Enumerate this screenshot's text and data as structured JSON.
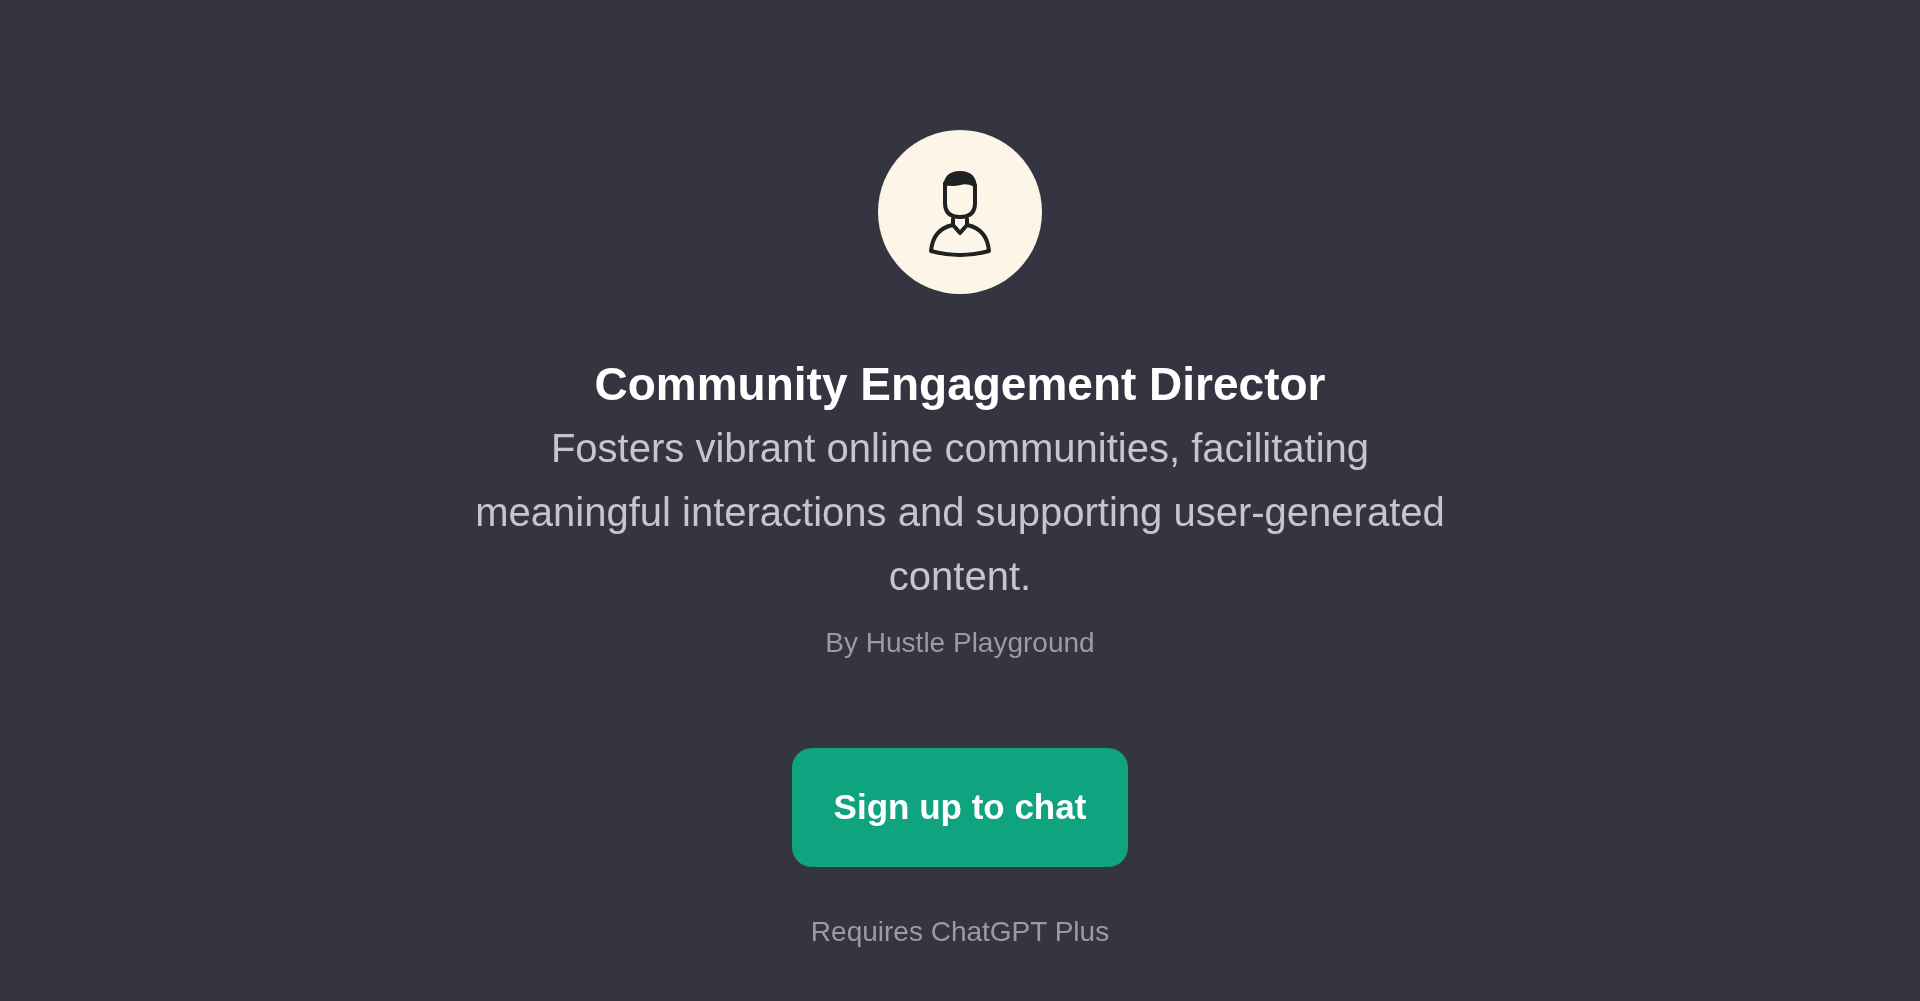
{
  "profile": {
    "title": "Community Engagement Director",
    "description": "Fosters vibrant online communities, facilitating meaningful interactions and supporting user-generated content.",
    "author": "By Hustle Playground"
  },
  "signup_button": {
    "label": "Sign up to chat"
  },
  "footnote": "Requires ChatGPT Plus"
}
